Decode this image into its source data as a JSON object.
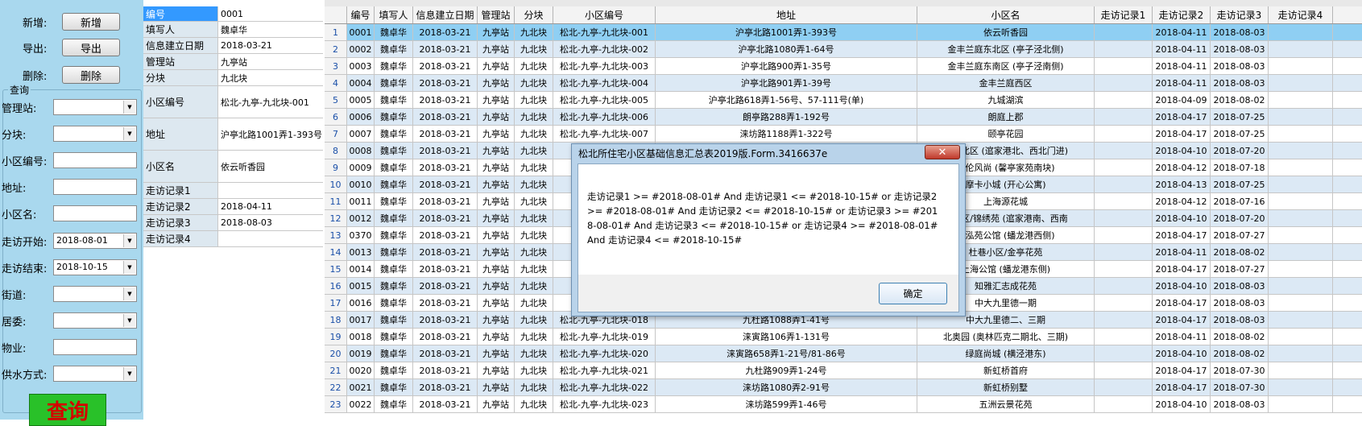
{
  "left": {
    "actions": [
      {
        "label": "新增:",
        "button": "新增"
      },
      {
        "label": "导出:",
        "button": "导出"
      },
      {
        "label": "删除:",
        "button": "删除"
      }
    ],
    "query_group_title": "查询",
    "fields": [
      {
        "label": "管理站:",
        "type": "select",
        "value": ""
      },
      {
        "label": "分块:",
        "type": "select",
        "value": ""
      },
      {
        "label": "小区编号:",
        "type": "text",
        "value": ""
      },
      {
        "label": "地址:",
        "type": "text",
        "value": ""
      },
      {
        "label": "小区名:",
        "type": "text",
        "value": ""
      },
      {
        "label": "走访开始:",
        "type": "select",
        "value": "2018-08-01"
      },
      {
        "label": "走访结束:",
        "type": "select",
        "value": "2018-10-15"
      },
      {
        "label": "街道:",
        "type": "select",
        "value": ""
      },
      {
        "label": "居委:",
        "type": "select",
        "value": ""
      },
      {
        "label": "物业:",
        "type": "text",
        "value": ""
      },
      {
        "label": "供水方式:",
        "type": "select",
        "value": ""
      }
    ],
    "query_button": "查询"
  },
  "detail": [
    {
      "label": "编号",
      "value": "0001"
    },
    {
      "label": "填写人",
      "value": "魏卓华"
    },
    {
      "label": "信息建立日期",
      "value": "2018-03-21"
    },
    {
      "label": "管理站",
      "value": "九亭站"
    },
    {
      "label": "分块",
      "value": "九北块"
    },
    {
      "label": "小区编号",
      "value": "松北-九亭-九北块-001"
    },
    {
      "label": "地址",
      "value": "沪亭北路1001弄1-393号"
    },
    {
      "label": "小区名",
      "value": "依云听香园"
    },
    {
      "label": "走访记录1",
      "value": ""
    },
    {
      "label": "走访记录2",
      "value": "2018-04-11"
    },
    {
      "label": "走访记录3",
      "value": "2018-08-03"
    },
    {
      "label": "走访记录4",
      "value": ""
    }
  ],
  "grid": {
    "headers": [
      "",
      "编号",
      "填写人",
      "信息建立日期",
      "管理站",
      "分块",
      "小区编号",
      "地址",
      "小区名",
      "走访记录1",
      "走访记录2",
      "走访记录3",
      "走访记录4"
    ],
    "rows": [
      [
        "1",
        "0001",
        "魏卓华",
        "2018-03-21",
        "九亭站",
        "九北块",
        "松北-九亭-九北块-001",
        "沪亭北路1001弄1-393号",
        "依云听香园",
        "",
        "2018-04-11",
        "2018-08-03",
        ""
      ],
      [
        "2",
        "0002",
        "魏卓华",
        "2018-03-21",
        "九亭站",
        "九北块",
        "松北-九亭-九北块-002",
        "沪亭北路1080弄1-64号",
        "金丰兰庭东北区 (亭子泾北侧)",
        "",
        "2018-04-11",
        "2018-08-03",
        ""
      ],
      [
        "3",
        "0003",
        "魏卓华",
        "2018-03-21",
        "九亭站",
        "九北块",
        "松北-九亭-九北块-003",
        "沪亭北路900弄1-35号",
        "金丰兰庭东南区 (亭子泾南侧)",
        "",
        "2018-04-11",
        "2018-08-03",
        ""
      ],
      [
        "4",
        "0004",
        "魏卓华",
        "2018-03-21",
        "九亭站",
        "九北块",
        "松北-九亭-九北块-004",
        "沪亭北路901弄1-39号",
        "金丰兰庭西区",
        "",
        "2018-04-11",
        "2018-08-03",
        ""
      ],
      [
        "5",
        "0005",
        "魏卓华",
        "2018-03-21",
        "九亭站",
        "九北块",
        "松北-九亭-九北块-005",
        "沪亭北路618弄1-56号、57-111号(单)",
        "九城湖滨",
        "",
        "2018-04-09",
        "2018-08-02",
        ""
      ],
      [
        "6",
        "0006",
        "魏卓华",
        "2018-03-21",
        "九亭站",
        "九北块",
        "松北-九亭-九北块-006",
        "朗亭路288弄1-192号",
        "朗庭上郡",
        "",
        "2018-04-17",
        "2018-07-25",
        ""
      ],
      [
        "7",
        "0007",
        "魏卓华",
        "2018-03-21",
        "九亭站",
        "九北块",
        "松北-九亭-九北块-007",
        "涞坊路1188弄1-322号",
        "颐亭花园",
        "",
        "2018-04-17",
        "2018-07-25",
        ""
      ],
      [
        "8",
        "0008",
        "魏卓华",
        "2018-03-21",
        "九亭站",
        "九北块",
        "",
        "",
        "小区北区 (逭家港北、西北门进)",
        "",
        "2018-04-10",
        "2018-07-20",
        ""
      ],
      [
        "9",
        "0009",
        "魏卓华",
        "2018-03-21",
        "九亭站",
        "九北块",
        "",
        "",
        "英伦风尚 (馨亭家苑南块)",
        "",
        "2018-04-12",
        "2018-07-18",
        ""
      ],
      [
        "10",
        "0010",
        "魏卓华",
        "2018-03-21",
        "九亭站",
        "九北块",
        "",
        "",
        "摩卡小城 (开心公寓)",
        "",
        "2018-04-13",
        "2018-07-25",
        ""
      ],
      [
        "11",
        "0011",
        "魏卓华",
        "2018-03-21",
        "九亭站",
        "九北块",
        "",
        "",
        "上海源花城",
        "",
        "2018-04-12",
        "2018-07-16",
        ""
      ],
      [
        "12",
        "0012",
        "魏卓华",
        "2018-03-21",
        "九亭站",
        "九北块",
        "",
        "",
        "区南区/锦绣苑 (逭家港南、西南",
        "",
        "2018-04-10",
        "2018-07-20",
        ""
      ],
      [
        "13",
        "0370",
        "魏卓华",
        "2018-03-21",
        "九亭站",
        "九北块",
        "",
        "",
        "闵泓苑公馆 (蟠龙港西侧)",
        "",
        "2018-04-17",
        "2018-07-27",
        ""
      ],
      [
        "14",
        "0013",
        "魏卓华",
        "2018-03-21",
        "九亭站",
        "九北块",
        "",
        "",
        "杜巷小区/金亭花苑",
        "",
        "2018-04-11",
        "2018-08-02",
        ""
      ],
      [
        "15",
        "0014",
        "魏卓华",
        "2018-03-21",
        "九亭站",
        "九北块",
        "",
        "",
        "上海公馆 (蟠龙港东侧)",
        "",
        "2018-04-17",
        "2018-07-27",
        ""
      ],
      [
        "16",
        "0015",
        "魏卓华",
        "2018-03-21",
        "九亭站",
        "九北块",
        "",
        "",
        "知雅汇志成花苑",
        "",
        "2018-04-10",
        "2018-08-03",
        ""
      ],
      [
        "17",
        "0016",
        "魏卓华",
        "2018-03-21",
        "九亭站",
        "九北块",
        "",
        "",
        "中大九里德一期",
        "",
        "2018-04-17",
        "2018-08-03",
        ""
      ],
      [
        "18",
        "0017",
        "魏卓华",
        "2018-03-21",
        "九亭站",
        "九北块",
        "松北-九亭-九北块-018",
        "九杜路1088弄1-41号",
        "中大九里德二、三期",
        "",
        "2018-04-17",
        "2018-08-03",
        ""
      ],
      [
        "19",
        "0018",
        "魏卓华",
        "2018-03-21",
        "九亭站",
        "九北块",
        "松北-九亭-九北块-019",
        "涞寅路106弄1-131号",
        "北奥园 (奥林匹克二期北、三期)",
        "",
        "2018-04-11",
        "2018-08-02",
        ""
      ],
      [
        "20",
        "0019",
        "魏卓华",
        "2018-03-21",
        "九亭站",
        "九北块",
        "松北-九亭-九北块-020",
        "涞寅路658弄1-21号/81-86号",
        "绿庭尚城 (横泾港东)",
        "",
        "2018-04-10",
        "2018-08-02",
        ""
      ],
      [
        "21",
        "0020",
        "魏卓华",
        "2018-03-21",
        "九亭站",
        "九北块",
        "松北-九亭-九北块-021",
        "九杜路909弄1-24号",
        "新虹桥首府",
        "",
        "2018-04-17",
        "2018-07-30",
        ""
      ],
      [
        "22",
        "0021",
        "魏卓华",
        "2018-03-21",
        "九亭站",
        "九北块",
        "松北-九亭-九北块-022",
        "涞坊路1080弄2-91号",
        "新虹桥别墅",
        "",
        "2018-04-17",
        "2018-07-30",
        ""
      ],
      [
        "23",
        "0022",
        "魏卓华",
        "2018-03-21",
        "九亭站",
        "九北块",
        "松北-九亭-九北块-023",
        "涞坊路599弄1-46号",
        "五洲云景花苑",
        "",
        "2018-04-10",
        "2018-08-03",
        ""
      ]
    ]
  },
  "dialog": {
    "title": "松北所住宅小区基础信息汇总表2019版.Form.3416637e",
    "close": "✕",
    "message": "走访记录1 >= #2018-08-01#  And 走访记录1 <= #2018-10-15#  or 走访记录2 >= #2018-08-01#  And 走访记录2 <= #2018-10-15#  or 走访记录3 >= #2018-08-01#  And 走访记录3 <= #2018-10-15#  or 走访记录4 >= #2018-08-01#  And 走访记录4 <= #2018-10-15#",
    "ok": "确定"
  }
}
